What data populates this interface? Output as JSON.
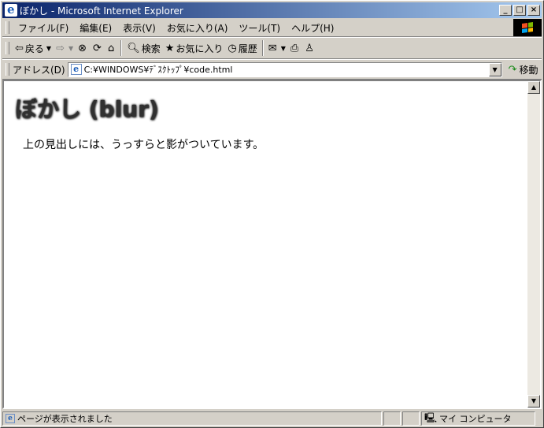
{
  "window": {
    "title": "ぼかし - Microsoft Internet Explorer",
    "minimize": "_",
    "maximize": "□",
    "close": "×"
  },
  "menubar": {
    "items": [
      "ファイル(F)",
      "編集(E)",
      "表示(V)",
      "お気に入り(A)",
      "ツール(T)",
      "ヘルプ(H)"
    ]
  },
  "toolbar": {
    "back_label": "戻る",
    "search_label": "検索",
    "favorites_label": "お気に入り",
    "history_label": "履歴"
  },
  "address": {
    "label": "アドレス(D)",
    "value": "C:¥WINDOWS¥ﾃﾞｽｸﾄｯﾌﾟ¥code.html",
    "go_label": "移動"
  },
  "page": {
    "heading": "ぼかし (blur)",
    "body_text": "上の見出しには、うっすらと影がついています。"
  },
  "status": {
    "message": "ページが表示されました",
    "zone": "マイ コンピュータ"
  }
}
